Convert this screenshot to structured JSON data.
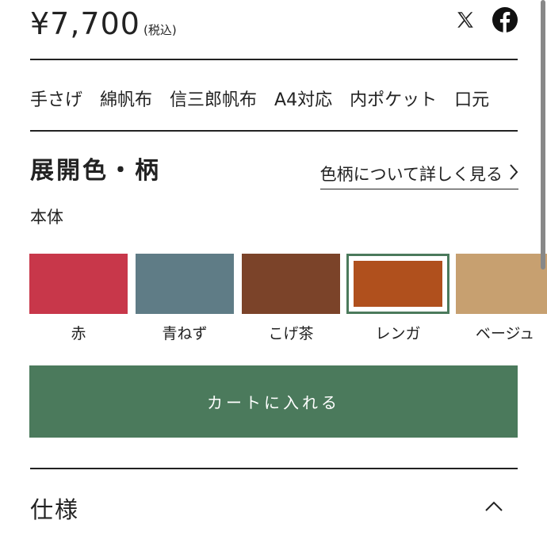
{
  "price": {
    "amount": "¥7,700",
    "tax_label": "(税込)"
  },
  "social": {
    "x_icon": "x-logo-icon",
    "facebook_icon": "facebook-icon"
  },
  "tags": [
    "手さげ",
    "綿帆布",
    "信三郎帆布",
    "A4対応",
    "内ポケット",
    "口元"
  ],
  "colors_section": {
    "title": "展開色・柄",
    "detail_link": "色柄について詳しく見る",
    "sub_label": "本体",
    "swatches": [
      {
        "label": "赤",
        "color": "#c8374a",
        "selected": false
      },
      {
        "label": "青ねず",
        "color": "#5f7c86",
        "selected": false
      },
      {
        "label": "こげ茶",
        "color": "#7b4329",
        "selected": false
      },
      {
        "label": "レンガ",
        "color": "#b0501d",
        "selected": true
      },
      {
        "label": "ベージュ",
        "color": "#c7a070",
        "selected": false
      }
    ]
  },
  "cart_button": "カートに入れる",
  "spec": {
    "title": "仕様"
  },
  "accent_color": "#4b7a5c"
}
